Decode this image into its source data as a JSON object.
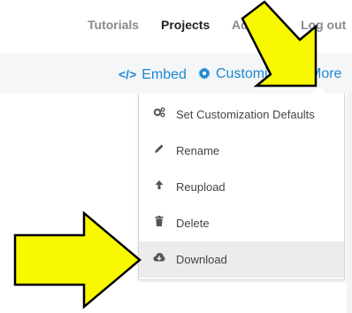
{
  "topnav": {
    "tutorials": "Tutorials",
    "projects": "Projects",
    "account": "Acc",
    "logout": "Log out"
  },
  "toolbar": {
    "embed": "Embed",
    "embed_icon": "</>",
    "customize": "Customize",
    "customize_icon": "gear-icon",
    "more": "More",
    "more_icon": "play-triangle-icon"
  },
  "menu": {
    "items": [
      {
        "label": "Set Customization Defaults",
        "icon": "cogs-icon"
      },
      {
        "label": "Rename",
        "icon": "pencil-icon"
      },
      {
        "label": "Reupload",
        "icon": "upload-arrow-icon"
      },
      {
        "label": "Delete",
        "icon": "trash-icon"
      },
      {
        "label": "Download",
        "icon": "cloud-download-icon"
      }
    ],
    "highlighted_index": 4
  },
  "annotations": {
    "arrow_color": "#f8f800",
    "arrow_outline": "#000000"
  },
  "colors": {
    "accent": "#1e88d3",
    "toolbar_bg": "#f4f6f8",
    "menu_hover": "#ececec"
  }
}
